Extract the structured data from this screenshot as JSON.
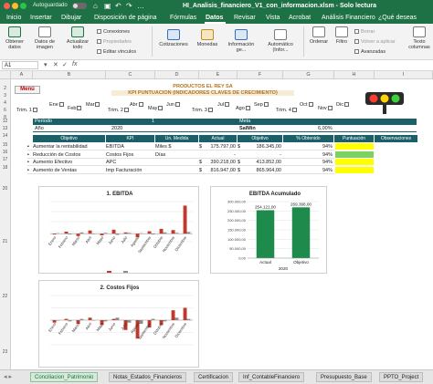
{
  "window": {
    "autosave_label": "Autoguardado",
    "title": "HI_Analisis_financiero_V1_con_informacion.xlsm - Solo lectura"
  },
  "ribbon_tabs": [
    {
      "label": "Inicio",
      "active": false
    },
    {
      "label": "Insertar",
      "active": false
    },
    {
      "label": "Dibujar",
      "active": false
    },
    {
      "label": "Disposición de página",
      "active": false
    },
    {
      "label": "Fórmulas",
      "active": false
    },
    {
      "label": "Datos",
      "active": true
    },
    {
      "label": "Revisar",
      "active": false
    },
    {
      "label": "Vista",
      "active": false
    },
    {
      "label": "Acrobat",
      "active": false
    },
    {
      "label": "Análisis Financiero",
      "active": false
    }
  ],
  "help_label": "¿Qué deseas",
  "ribbon": {
    "obtener_datos": "Obtener datos",
    "datos_imagen": "Datos de imagen",
    "actualizar_todo": "Actualizar todo",
    "conexiones": "Conexiones",
    "propiedades": "Propiedades",
    "editar_vinculos": "Editar vínculos",
    "cotizaciones": "Cotizaciones",
    "monedas": "Monedas",
    "informacion_geo": "Información ge...",
    "automatico": "Automático (Infor...",
    "borrar": "Borrar",
    "volver_aplicar": "Volver a aplicar",
    "ordenar": "Ordenar",
    "filtro": "Filtro",
    "avanzadas": "Avanzadas",
    "texto_col": "Texto columnas"
  },
  "formula_bar": {
    "name_box": "A1",
    "fx": "fx"
  },
  "columns": [
    "A",
    "B",
    "C",
    "D",
    "E",
    "F",
    "G",
    "H",
    "I"
  ],
  "rows": [
    "2",
    "3",
    "4",
    "6",
    "8",
    "12",
    "13",
    "14",
    "15",
    "16",
    "17",
    "18",
    "20",
    "21",
    "22",
    "23"
  ],
  "sheet": {
    "menu_label": "Menú",
    "title1": "PRODUCTOS EL REY SA",
    "title2": "KPI PUNTUACION (INDICADORES CLAVES DE CRECIMIENTO)",
    "months": [
      "Ene",
      "Feb",
      "Mar",
      "Abr",
      "May",
      "Jun",
      "Jul",
      "Ago",
      "Sep",
      "Oct",
      "Nov",
      "Dic"
    ],
    "trims": [
      "Trim. 1",
      "Trim. 2",
      "Trim. 3",
      "Trim. 4"
    ],
    "periodo_label": "Periodo",
    "periodo_value": "1",
    "anio_label": "Año",
    "anio_value": "2020",
    "meta_label": "Meta",
    "salmin_label": "SalMin",
    "salmin_value": "6,00%"
  },
  "kpi_table": {
    "headers": [
      "Objetivo",
      "KPI",
      "Un. Medida",
      "Actual",
      "Objetivo",
      "% Obtenido",
      "Puntuación",
      "Observaciones"
    ],
    "rows": [
      {
        "objetivo": "Aumentar la rentabilidad",
        "kpi": "EBITDA",
        "medida": "Miles $",
        "cur": "$",
        "actual": "175.797,00",
        "cur2": "$",
        "obj": "186.345,00",
        "pct": "94%",
        "status": "#ffff00"
      },
      {
        "objetivo": "Reducción de Costos",
        "kpi": "Costos Fijos",
        "medida": "Días",
        "cur": "",
        "actual": "-",
        "cur2": "",
        "obj": "-",
        "pct": "94%",
        "status": "#7cd15f"
      },
      {
        "objetivo": "Aumento Efectivo",
        "kpi": "APC",
        "medida": "",
        "cur": "$",
        "actual": "390.218,00",
        "cur2": "$",
        "obj": "413.852,00",
        "pct": "94%",
        "status": "#ffff00"
      },
      {
        "objetivo": "Aumento de Ventas",
        "kpi": "Imp Facturación",
        "medida": "",
        "cur": "$",
        "actual": "816.947,00",
        "cur2": "$",
        "obj": "865.964,00",
        "pct": "94%",
        "status": "#ffff00"
      }
    ]
  },
  "chart_data": [
    {
      "type": "bar",
      "title": "1. EBITDA",
      "categories": [
        "Enero",
        "Febrero",
        "Marzo",
        "Abril",
        "Mayo",
        "Junio",
        "Julio",
        "Agosto",
        "Septiembre",
        "Octubre",
        "Noviembre",
        "Diciembre"
      ],
      "series": [
        {
          "values": [
            -2,
            5,
            -6,
            8,
            -4,
            10,
            3,
            -9,
            6,
            12,
            9,
            70
          ],
          "color": "#c0392b"
        },
        {
          "values": [
            1,
            -2,
            3,
            -1,
            2,
            -3,
            2,
            1,
            -2,
            3,
            2,
            4
          ],
          "color": "#8c8c8c"
        }
      ],
      "ylim": [
        -20,
        80
      ],
      "legend": "bottom"
    },
    {
      "type": "bar",
      "title": "EBITDA Acumulado",
      "categories": [
        "Actual",
        "Objetivo"
      ],
      "values": [
        254121,
        269368
      ],
      "data_labels": [
        "254.121,00",
        "269.368,00"
      ],
      "xgroup_label": "2020",
      "ylim": [
        0,
        300000
      ],
      "yticks": [
        "300.000,00",
        "250.000,00",
        "200.000,00",
        "150.000,00",
        "100.000,00",
        "50.000,00",
        "0,00"
      ],
      "color": "#1e8a4c"
    },
    {
      "type": "bar",
      "title": "2. Costos Fijos",
      "categories": [
        "Enero",
        "Febrero",
        "Marzo",
        "Abril",
        "Mayo",
        "Junio",
        "Julio",
        "Agosto",
        "Septiembre",
        "Octubre",
        "Noviembre",
        "Diciembre"
      ],
      "series": [
        {
          "values": [
            -2,
            1,
            -3,
            2,
            -4,
            1,
            -8,
            -15,
            -6,
            -4,
            8,
            10
          ],
          "color": "#c0392b"
        },
        {
          "values": [
            0,
            -1,
            1,
            0,
            -1,
            2,
            -2,
            -3,
            1,
            -1,
            2,
            1
          ],
          "color": "#8c8c8c"
        }
      ],
      "ylim": [
        -20,
        20
      ]
    }
  ],
  "sheet_tabs": [
    {
      "label": "Conciliacion_Patrimonio",
      "active": true
    },
    {
      "label": "Notas_Estados_Financieros",
      "active": false
    },
    {
      "label": "Certificacion",
      "active": false
    },
    {
      "label": "Inf_ContableFinanciero",
      "active": false
    },
    {
      "label": "Presupuesto_Base",
      "active": false
    },
    {
      "label": "PPTO_Project",
      "active": false
    }
  ]
}
